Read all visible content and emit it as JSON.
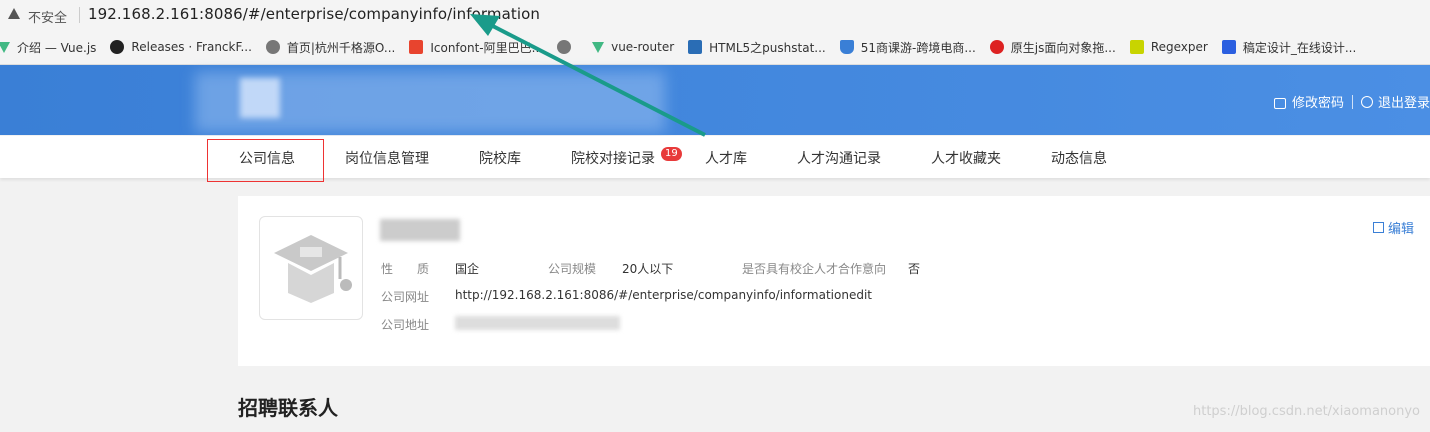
{
  "browser": {
    "security_label": "不安全",
    "url": "192.168.2.161:8086/#/enterprise/companyinfo/information",
    "bookmarks": [
      {
        "label": "介绍 — Vue.js",
        "icon": "vue-icon",
        "color": "#41b883"
      },
      {
        "label": "Releases · FranckF...",
        "icon": "github-icon",
        "color": "#222222"
      },
      {
        "label": "首页|杭州千格源O...",
        "icon": "globe-icon",
        "color": "#666666"
      },
      {
        "label": "Iconfont-阿里巴巴...",
        "icon": "iconfont-icon",
        "color": "#e8442e"
      },
      {
        "label": "",
        "icon": "globe-icon",
        "color": "#666666"
      },
      {
        "label": "vue-router",
        "icon": "vue-icon",
        "color": "#41b883"
      },
      {
        "label": "HTML5之pushstat...",
        "icon": "doc-icon",
        "color": "#2a6db5"
      },
      {
        "label": "51商课游-跨境电商...",
        "icon": "graduation-cap-icon",
        "color": "#3a7fd6"
      },
      {
        "label": "原生js面向对象拖...",
        "icon": "circle-icon",
        "color": "#d22"
      },
      {
        "label": "Regexper",
        "icon": "regexper-icon",
        "color": "#c8d400"
      },
      {
        "label": "稿定设计_在线设计...",
        "icon": "gaoding-icon",
        "color": "#2b5fe0"
      }
    ]
  },
  "header": {
    "change_password": "修改密码",
    "logout": "退出登录"
  },
  "nav": {
    "items": [
      {
        "label": "公司信息"
      },
      {
        "label": "岗位信息管理"
      },
      {
        "label": "院校库"
      },
      {
        "label": "院校对接记录"
      },
      {
        "label": "人才库"
      },
      {
        "label": "人才沟通记录"
      },
      {
        "label": "人才收藏夹"
      },
      {
        "label": "动态信息"
      }
    ],
    "badge_count": "19"
  },
  "company": {
    "edit_label": "编辑",
    "nature_label": "性　　质",
    "nature_value": "国企",
    "scale_label": "公司规模",
    "scale_value": "20人以下",
    "coop_label": "是否具有校企人才合作意向",
    "coop_value": "否",
    "website_label": "公司网址",
    "website_value": "http://192.168.2.161:8086/#/enterprise/companyinfo/informationedit",
    "address_label": "公司地址"
  },
  "section": {
    "recruit_contact_title": "招聘联系人"
  },
  "watermark": "https://blog.csdn.net/xiaomanonyo",
  "colors": {
    "brand_blue": "#3a7fd6",
    "badge_red": "#e83a3a",
    "arrow_teal": "#1a9b8a"
  }
}
